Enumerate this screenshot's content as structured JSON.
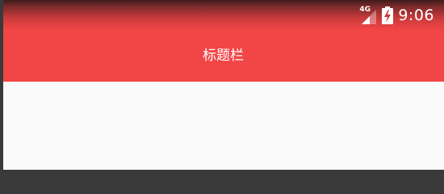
{
  "status_bar": {
    "network_type": "4G",
    "time": "9:06",
    "signal_icon": "signal-icon",
    "battery_icon": "battery-charging-icon"
  },
  "toolbar": {
    "title": "标题栏"
  },
  "colors": {
    "primary": "#f24546",
    "background": "#fafafa",
    "text_on_primary": "#ffffff"
  }
}
